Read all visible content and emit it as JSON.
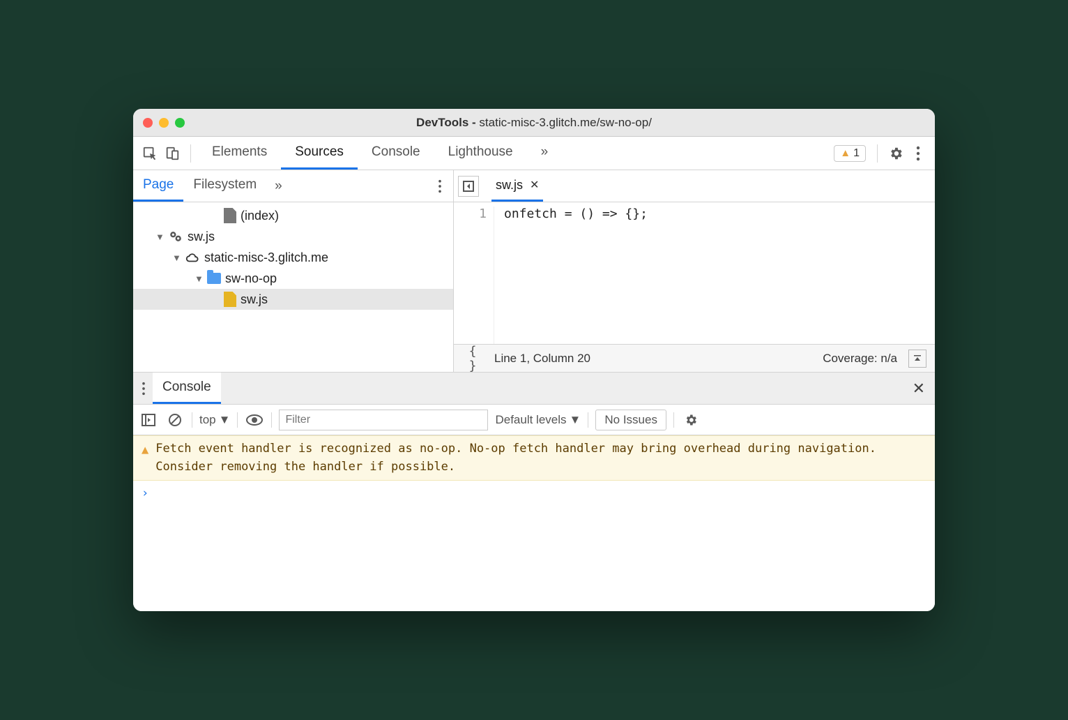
{
  "window": {
    "title_prefix": "DevTools - ",
    "title_domain": "static-misc-3.glitch.me/sw-no-op/"
  },
  "main_tabs": {
    "elements": "Elements",
    "sources": "Sources",
    "console": "Console",
    "lighthouse": "Lighthouse",
    "overflow": "»"
  },
  "warning_count": "1",
  "left_panel": {
    "tabs": {
      "page": "Page",
      "filesystem": "Filesystem",
      "overflow": "»"
    },
    "tree": {
      "index": "(index)",
      "worker": "sw.js",
      "domain": "static-misc-3.glitch.me",
      "folder": "sw-no-op",
      "file": "sw.js"
    }
  },
  "editor": {
    "open_file": "sw.js",
    "line_number": "1",
    "code": "onfetch = () => {};",
    "status_pos": "Line 1, Column 20",
    "coverage": "Coverage: n/a"
  },
  "drawer": {
    "tab": "Console"
  },
  "console": {
    "context": "top",
    "filter_placeholder": "Filter",
    "levels": "Default levels",
    "no_issues": "No Issues",
    "warning": "Fetch event handler is recognized as no-op. No-op fetch handler may bring overhead during navigation. Consider removing the handler if possible.",
    "prompt": "›"
  }
}
